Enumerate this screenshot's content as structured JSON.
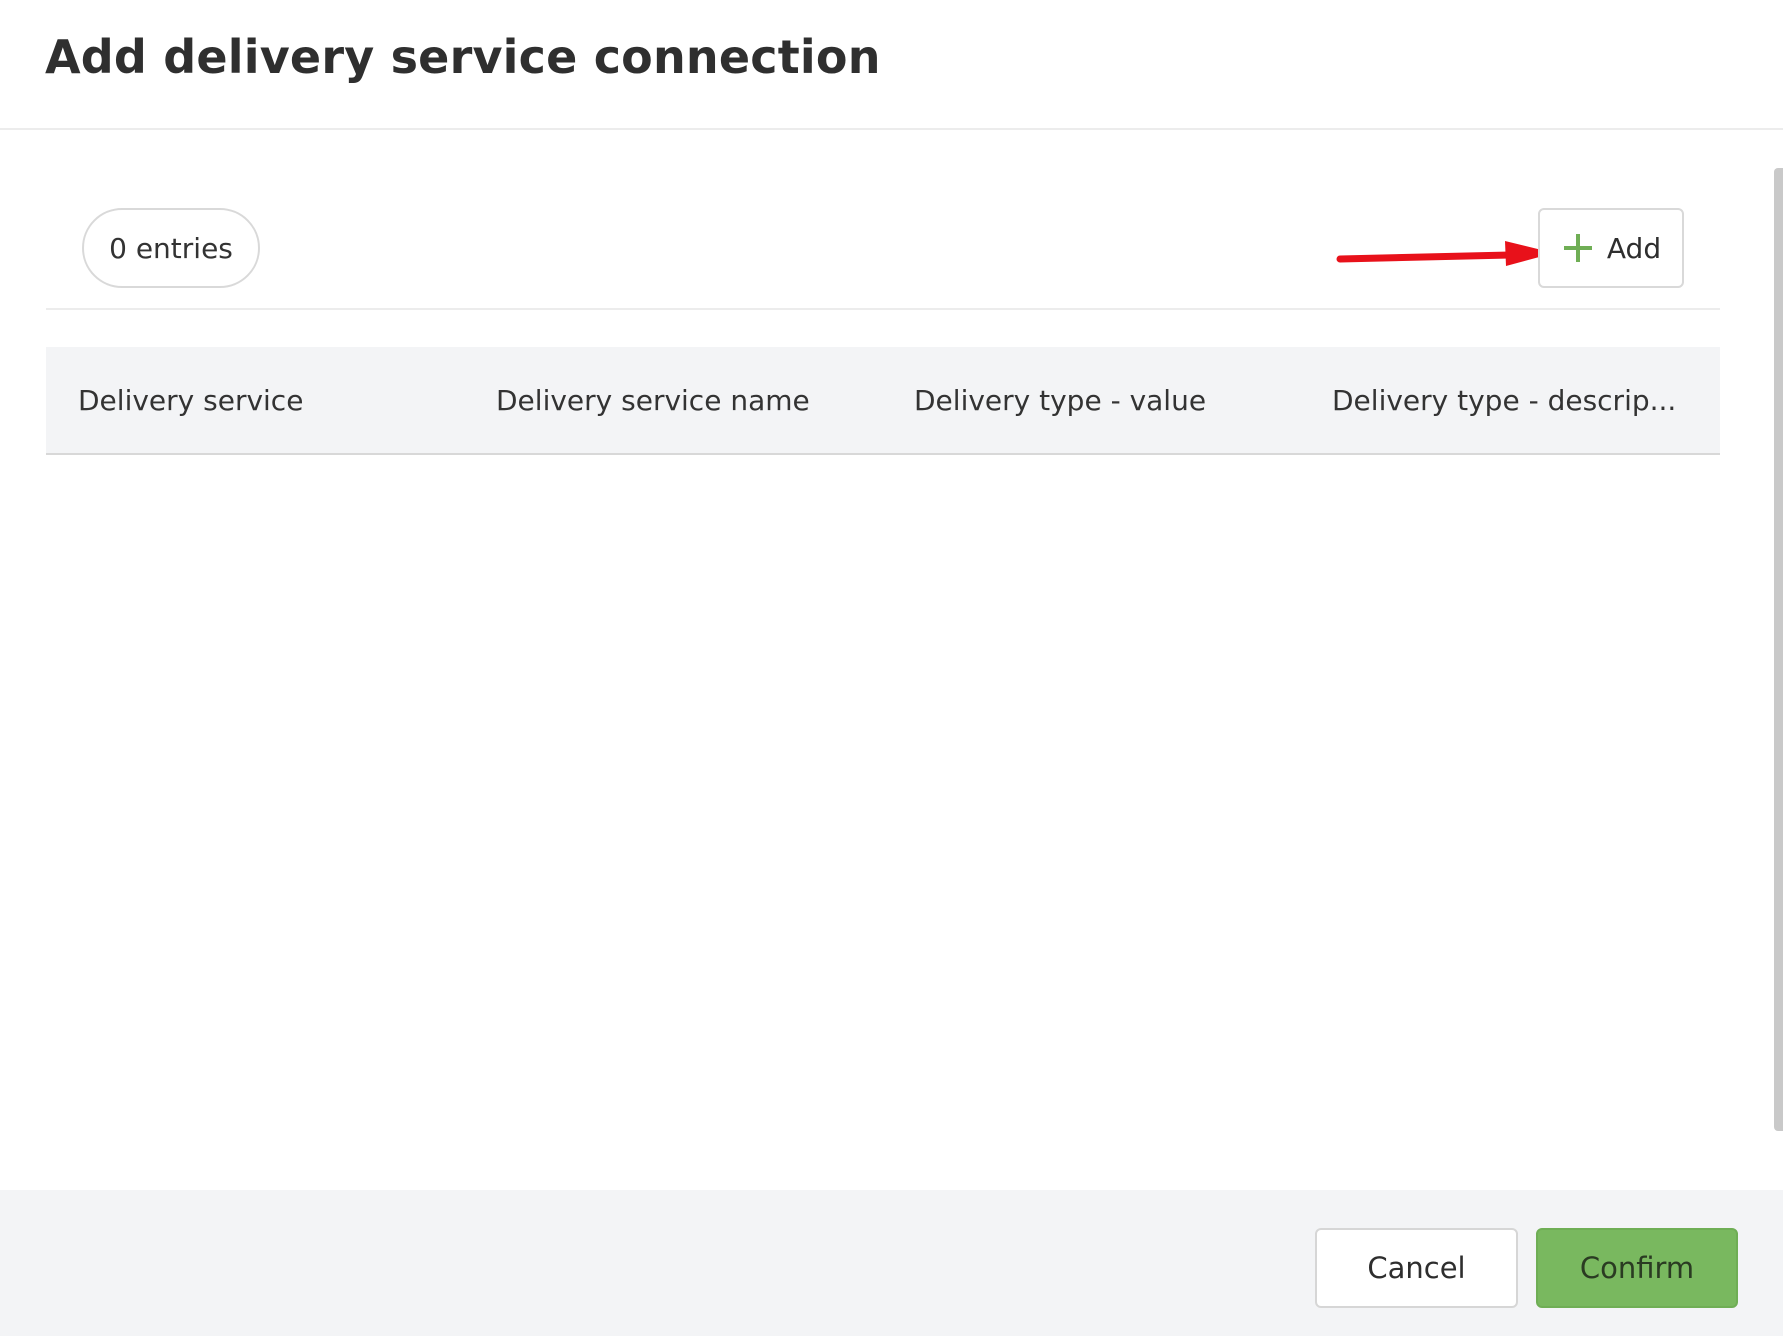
{
  "dialog": {
    "title": "Add delivery service connection"
  },
  "toolbar": {
    "entries_count": "0 entries",
    "add_label": "Add",
    "add_icon": "plus-icon",
    "annotation": "red-arrow-pointing-to-add"
  },
  "table": {
    "columns": [
      {
        "label": "Delivery service"
      },
      {
        "label": "Delivery service name"
      },
      {
        "label": "Delivery type - value"
      },
      {
        "label": "Delivery type - descrip..."
      }
    ],
    "rows": []
  },
  "footer": {
    "cancel_label": "Cancel",
    "confirm_label": "Confirm"
  },
  "colors": {
    "accent_green": "#79b85f",
    "plus_icon": "#6fae55",
    "annotation_red": "#e8111a",
    "header_bg": "#f3f4f6"
  }
}
